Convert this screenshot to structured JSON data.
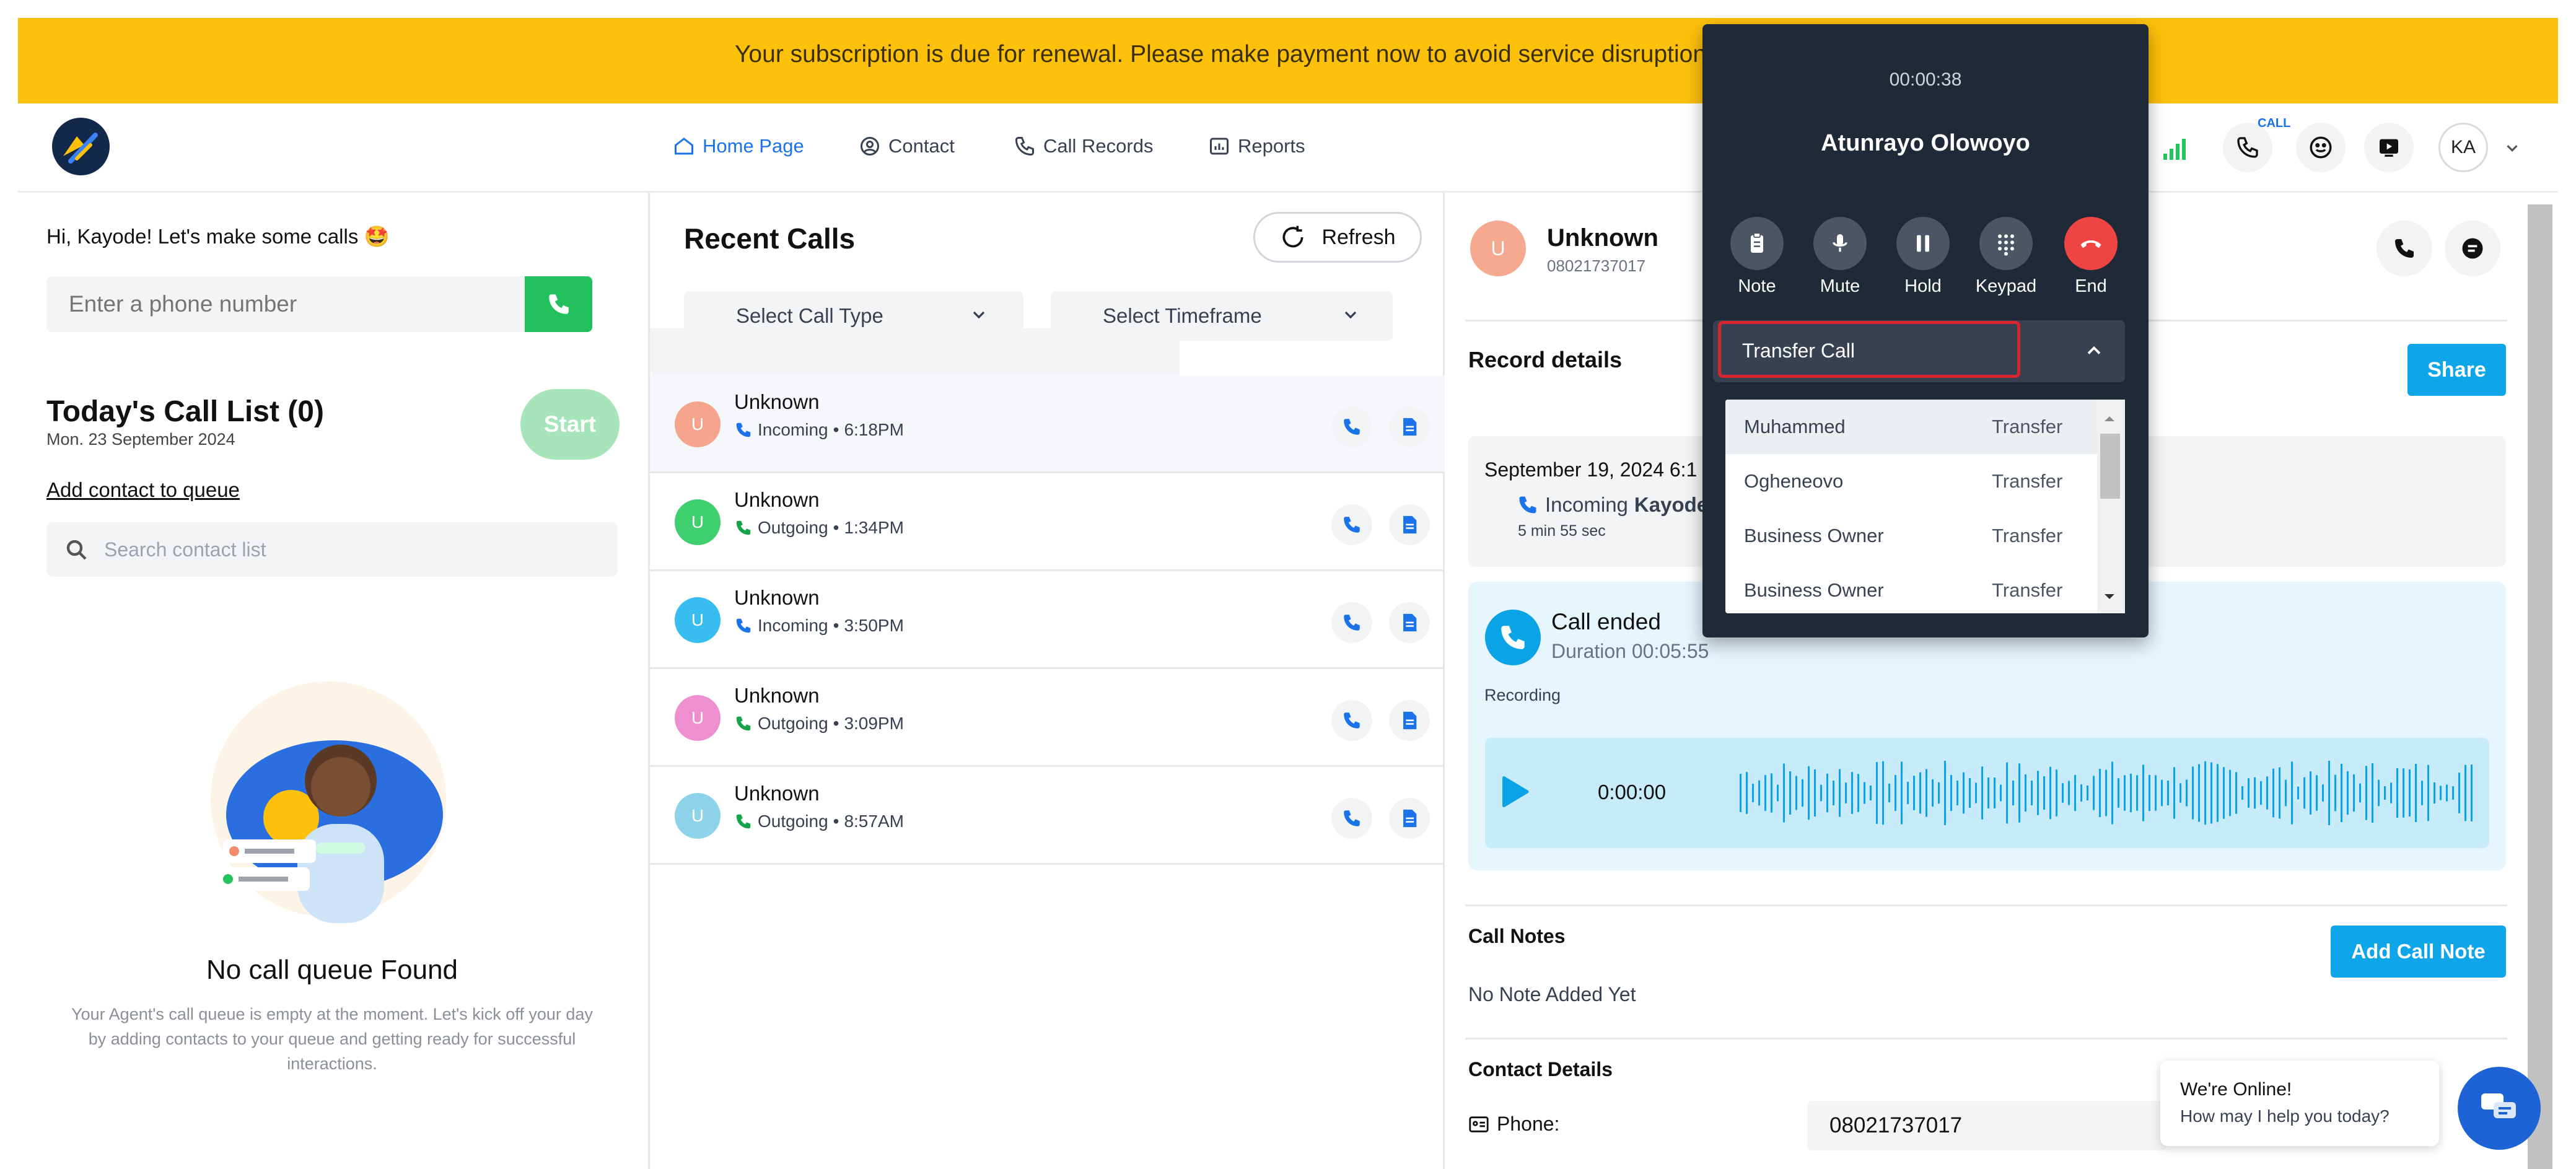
{
  "banner": {
    "text": "Your subscription is due for renewal. Please make payment now to avoid service disruption."
  },
  "nav": [
    {
      "label": "Home Page",
      "icon": "home-icon",
      "active": true
    },
    {
      "label": "Contact",
      "icon": "contact-icon"
    },
    {
      "label": "Call Records",
      "icon": "call-records-icon"
    },
    {
      "label": "Reports",
      "icon": "reports-icon"
    }
  ],
  "header": {
    "call_badge": "CALL",
    "avatar_initials": "KA"
  },
  "left": {
    "greeting": "Hi, Kayode! Let's make some calls 🤩",
    "phone_placeholder": "Enter a phone number",
    "call_list_title": "Today's Call List (0)",
    "call_list_date": "Mon. 23 September 2024",
    "start_label": "Start",
    "add_to_queue": "Add contact to queue",
    "search_placeholder": "Search contact list",
    "empty_title": "No call queue Found",
    "empty_desc": "Your Agent's call queue is empty at the moment. Let's kick off your day by adding contacts to your queue and getting ready for successful interactions."
  },
  "recent": {
    "title": "Recent Calls",
    "refresh_label": "Refresh",
    "select_type": "Select Call Type",
    "select_timeframe": "Select Timeframe",
    "calls": [
      {
        "initial": "U",
        "name": "Unknown",
        "direction": "Incoming",
        "time": "6:18PM",
        "color": "#f7a48c"
      },
      {
        "initial": "U",
        "name": "Unknown",
        "direction": "Outgoing",
        "time": "1:34PM",
        "color": "#3fcf6e"
      },
      {
        "initial": "U",
        "name": "Unknown",
        "direction": "Incoming",
        "time": "3:50PM",
        "color": "#38bdf0"
      },
      {
        "initial": "U",
        "name": "Unknown",
        "direction": "Outgoing",
        "time": "3:09PM",
        "color": "#ee8fd0"
      },
      {
        "initial": "U",
        "name": "Unknown",
        "direction": "Outgoing",
        "time": "8:57AM",
        "color": "#8fd3ea"
      }
    ]
  },
  "contact": {
    "initial": "U",
    "name": "Unknown",
    "number": "08021737017",
    "record_title": "Record details",
    "share_label": "Share",
    "record_date": "September 19, 2024 6:1",
    "record_direction": "Incoming",
    "record_agent": "Kayode",
    "record_duration": "5 min 55 sec",
    "ended_title": "Call ended",
    "ended_duration": "Duration 00:05:55",
    "recording_label": "Recording",
    "player_time": "0:00:00",
    "notes_title": "Call Notes",
    "add_note_label": "Add Call Note",
    "no_note": "No Note Added Yet",
    "details_title": "Contact Details",
    "phone_label": "Phone:",
    "phone_value": "08021737017"
  },
  "popup": {
    "timer": "00:00:38",
    "caller": "Atunrayo Olowoyo",
    "controls": [
      {
        "label": "Note",
        "icon": "clipboard-icon"
      },
      {
        "label": "Mute",
        "icon": "microphone-icon"
      },
      {
        "label": "Hold",
        "icon": "pause-icon"
      },
      {
        "label": "Keypad",
        "icon": "keypad-icon"
      },
      {
        "label": "End",
        "icon": "hangup-icon"
      }
    ],
    "transfer_label": "Transfer Call",
    "transfer_targets": [
      {
        "name": "Muhammed",
        "action": "Transfer"
      },
      {
        "name": "Ogheneovo",
        "action": "Transfer"
      },
      {
        "name": "Business Owner",
        "action": "Transfer"
      },
      {
        "name": "Business Owner",
        "action": "Transfer"
      }
    ]
  },
  "chat": {
    "online": "We're Online!",
    "help": "How may I help you today?"
  }
}
